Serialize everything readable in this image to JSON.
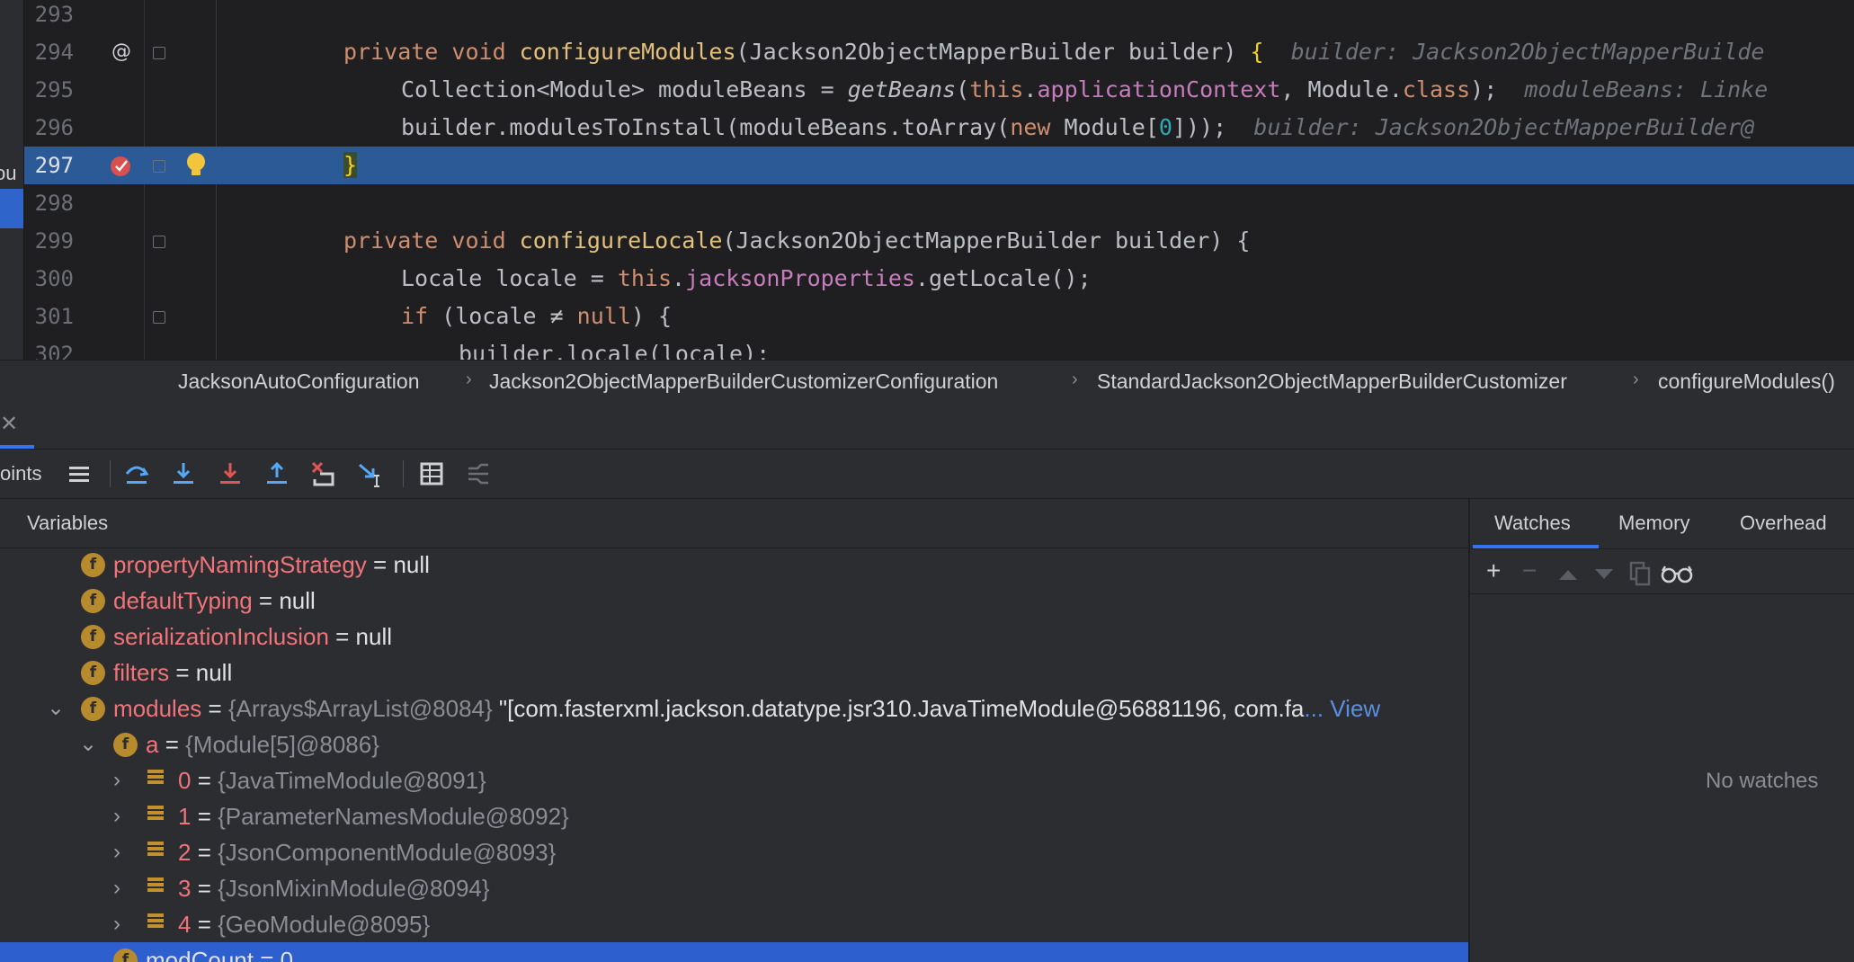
{
  "editor": {
    "lines": [
      {
        "num": "293"
      },
      {
        "num": "294"
      },
      {
        "num": "295"
      },
      {
        "num": "296"
      },
      {
        "num": "297"
      },
      {
        "num": "298"
      },
      {
        "num": "299"
      },
      {
        "num": "300"
      },
      {
        "num": "301"
      },
      {
        "num": "302"
      }
    ],
    "code": {
      "l294_a": "private void ",
      "l294_b": "configureModules",
      "l294_c": "(Jackson2ObjectMapperBuilder builder) ",
      "l294_d": "{",
      "l294_hint": "builder: Jackson2ObjectMapperBuilde",
      "l295_a": "Collection<Module> moduleBeans = ",
      "l295_b": "getBeans",
      "l295_c": "(",
      "l295_d": "this",
      "l295_e": ".",
      "l295_f": "applicationContext",
      "l295_g": ", Module.",
      "l295_h": "class",
      "l295_i": ");",
      "l295_hint": "moduleBeans: Linke",
      "l296_a": "builder.modulesToInstall(moduleBeans.toArray(",
      "l296_b": "new ",
      "l296_c": "Module[",
      "l296_d": "0",
      "l296_e": "]));",
      "l296_hint": "builder: Jackson2ObjectMapperBuilder@",
      "l297_a": "}",
      "l299_a": "private void ",
      "l299_b": "configureLocale",
      "l299_c": "(Jackson2ObjectMapperBuilder builder) {",
      "l300_a": "Locale locale = ",
      "l300_b": "this",
      "l300_c": ".",
      "l300_d": "jacksonProperties",
      "l300_e": ".getLocale();",
      "l301_a": "if ",
      "l301_b": "(locale ≠ ",
      "l301_c": "null",
      "l301_d": ") {",
      "l302_a": "builder.locale(locale);"
    },
    "gutter_symbol": "@"
  },
  "breadcrumbs": [
    "JacksonAutoConfiguration",
    "Jackson2ObjectMapperBuilderCustomizerConfiguration",
    "StandardJackson2ObjectMapperBuilderCustomizer",
    "configureModules()"
  ],
  "left_strip_label": "ou",
  "toolbar": {
    "label": "oints"
  },
  "variables": {
    "title": "Variables",
    "rows": [
      {
        "name": "propertyNamingStrategy",
        "eq": " = ",
        "value": "null",
        "type": "",
        "extra": ""
      },
      {
        "name": "defaultTyping",
        "eq": " = ",
        "value": "null",
        "type": "",
        "extra": ""
      },
      {
        "name": "serializationInclusion",
        "eq": " = ",
        "value": "null",
        "type": "",
        "extra": ""
      },
      {
        "name": "filters",
        "eq": " = ",
        "value": "null",
        "type": "",
        "extra": ""
      },
      {
        "name": "modules",
        "eq": " = ",
        "type": "{Arrays$ArrayList@8084} ",
        "value": "\"[com.fasterxml.jackson.datatype.jsr310.JavaTimeModule@56881196, com.fa",
        "extra": "... View"
      },
      {
        "name": "a",
        "eq": " = ",
        "type": "{Module[5]@8086}",
        "value": "",
        "extra": ""
      },
      {
        "name": "0",
        "eq": " = ",
        "type": "{JavaTimeModule@8091}",
        "value": "",
        "extra": ""
      },
      {
        "name": "1",
        "eq": " = ",
        "type": "{ParameterNamesModule@8092}",
        "value": "",
        "extra": ""
      },
      {
        "name": "2",
        "eq": " = ",
        "type": "{JsonComponentModule@8093}",
        "value": "",
        "extra": ""
      },
      {
        "name": "3",
        "eq": " = ",
        "type": "{JsonMixinModule@8094}",
        "value": "",
        "extra": ""
      },
      {
        "name": "4",
        "eq": " = ",
        "type": "{GeoModule@8095}",
        "value": "",
        "extra": ""
      },
      {
        "name": "modCount",
        "eq": " = ",
        "value": "0",
        "type": "",
        "extra": ""
      }
    ],
    "field_icon_letter": "f"
  },
  "watches": {
    "tabs": [
      "Watches",
      "Memory",
      "Overhead"
    ],
    "empty_text": "No watches",
    "buttons": {
      "add": "+",
      "remove": "−"
    }
  },
  "colors": {
    "highlight_line": "#2c5a97",
    "selected_row": "#2e5fcf",
    "field_icon": "#b88a2e",
    "variable_name": "#f0747a"
  }
}
